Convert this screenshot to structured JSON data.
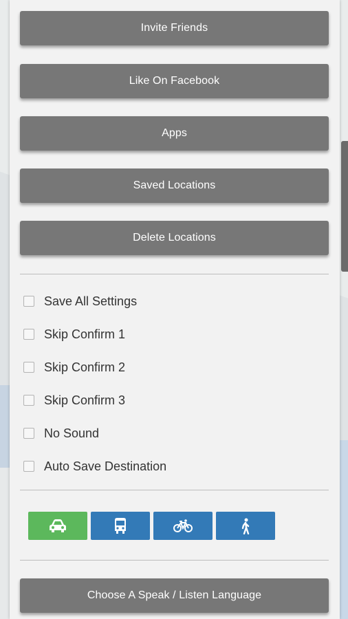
{
  "menu": {
    "buttons": [
      {
        "label": "Invite Friends"
      },
      {
        "label": "Like On Facebook"
      },
      {
        "label": "Apps"
      },
      {
        "label": "Saved Locations"
      },
      {
        "label": "Delete Locations"
      }
    ]
  },
  "settings": {
    "checkboxes": [
      {
        "label": "Save All Settings",
        "checked": false
      },
      {
        "label": "Skip Confirm 1",
        "checked": false
      },
      {
        "label": "Skip Confirm 2",
        "checked": false
      },
      {
        "label": "Skip Confirm 3",
        "checked": false
      },
      {
        "label": "No Sound",
        "checked": false
      },
      {
        "label": "Auto Save Destination",
        "checked": false
      }
    ]
  },
  "travel_modes": [
    {
      "icon": "car-icon",
      "color": "#5cb85c",
      "selected": true
    },
    {
      "icon": "bus-icon",
      "color": "#337ab7",
      "selected": false
    },
    {
      "icon": "bicycle-icon",
      "color": "#337ab7",
      "selected": false
    },
    {
      "icon": "walking-icon",
      "color": "#337ab7",
      "selected": false
    }
  ],
  "language_button": {
    "label": "Choose A Speak / Listen Language"
  },
  "colors": {
    "button_gray": "#777777",
    "accent_green": "#5cb85c",
    "accent_blue": "#337ab7",
    "panel_bg": "#f2f2f2"
  }
}
